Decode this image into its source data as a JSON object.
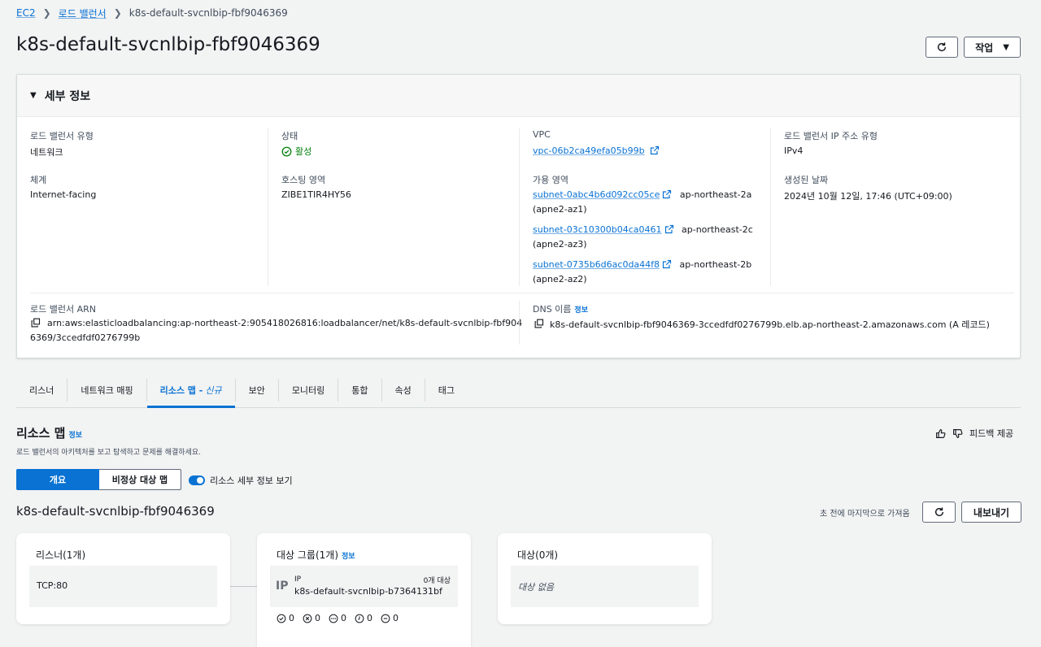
{
  "breadcrumb": {
    "ec2": "EC2",
    "lb": "로드 밸런서",
    "current": "k8s-default-svcnlbip-fbf9046369"
  },
  "page": {
    "title": "k8s-default-svcnlbip-fbf9046369",
    "actions_label": "작업"
  },
  "details": {
    "header": "세부 정보",
    "lb_type_label": "로드 밸런서 유형",
    "lb_type": "네트워크",
    "scheme_label": "체계",
    "scheme": "Internet-facing",
    "state_label": "상태",
    "state": "활성",
    "hosted_zone_label": "호스팅 영역",
    "hosted_zone": "ZIBE1TIR4HY56",
    "vpc_label": "VPC",
    "vpc": "vpc-06b2ca49efa05b99b",
    "az_label": "가용 영역",
    "subnets": [
      {
        "id": "subnet-0abc4b6d092cc05ce",
        "zone": "ap-northeast-2a",
        "az": "(apne2-az1)"
      },
      {
        "id": "subnet-03c10300b04ca0461",
        "zone": "ap-northeast-2c",
        "az": "(apne2-az3)"
      },
      {
        "id": "subnet-0735b6d6ac0da44f8",
        "zone": "ap-northeast-2b",
        "az": "(apne2-az2)"
      }
    ],
    "ip_type_label": "로드 밸런서 IP 주소 유형",
    "ip_type": "IPv4",
    "created_label": "생성된 날짜",
    "created": "2024년 10월 12일, 17:46 (UTC+09:00)",
    "arn_label": "로드 밸런서 ARN",
    "arn_line1": "arn:aws:elasticloadbalancing:ap-northeast-2:905418026816:loadbalancer/net/k8s-default-svcnlbip-fbf904",
    "arn_line2": "6369/3ccedfdf0276799b",
    "dns_label": "DNS 이름",
    "dns_info": "정보",
    "dns": "k8s-default-svcnlbip-fbf9046369-3ccedfdf0276799b.elb.ap-northeast-2.amazonaws.com (A 레코드)"
  },
  "tabs": [
    {
      "label": "리스너"
    },
    {
      "label": "네트워크 매핑"
    },
    {
      "label": "리소스 맵 - ",
      "tag": "신규"
    },
    {
      "label": "보안"
    },
    {
      "label": "모니터링"
    },
    {
      "label": "통합"
    },
    {
      "label": "속성"
    },
    {
      "label": "태그"
    }
  ],
  "resource_map": {
    "title": "리소스 맵",
    "info": "정보",
    "desc": "로드 밸런서의 아키텍처를 보고 탐색하고 문제를 해결하세요.",
    "feedback": "피드백 제공",
    "view_overview": "개요",
    "view_unhealthy": "비정상 대상 맵",
    "toggle_label": "리소스 세부 정보 보기",
    "lb_name": "k8s-default-svcnlbip-fbf9046369",
    "fetched": "초 전에 마지막으로 가져옴",
    "export": "내보내기",
    "listeners_title": "리스너(1개)",
    "listener": "TCP:80",
    "tg_title": "대상 그룹(1개)",
    "tg_info": "정보",
    "tg_type": "IP",
    "tg_targets": "0개 대상",
    "tg_name": "k8s-default-svcnlbip-b7364131bf",
    "tg_counts": [
      "0",
      "0",
      "0",
      "0",
      "0"
    ],
    "targets_title": "대상(0개)",
    "targets_empty": "대상 없음"
  }
}
